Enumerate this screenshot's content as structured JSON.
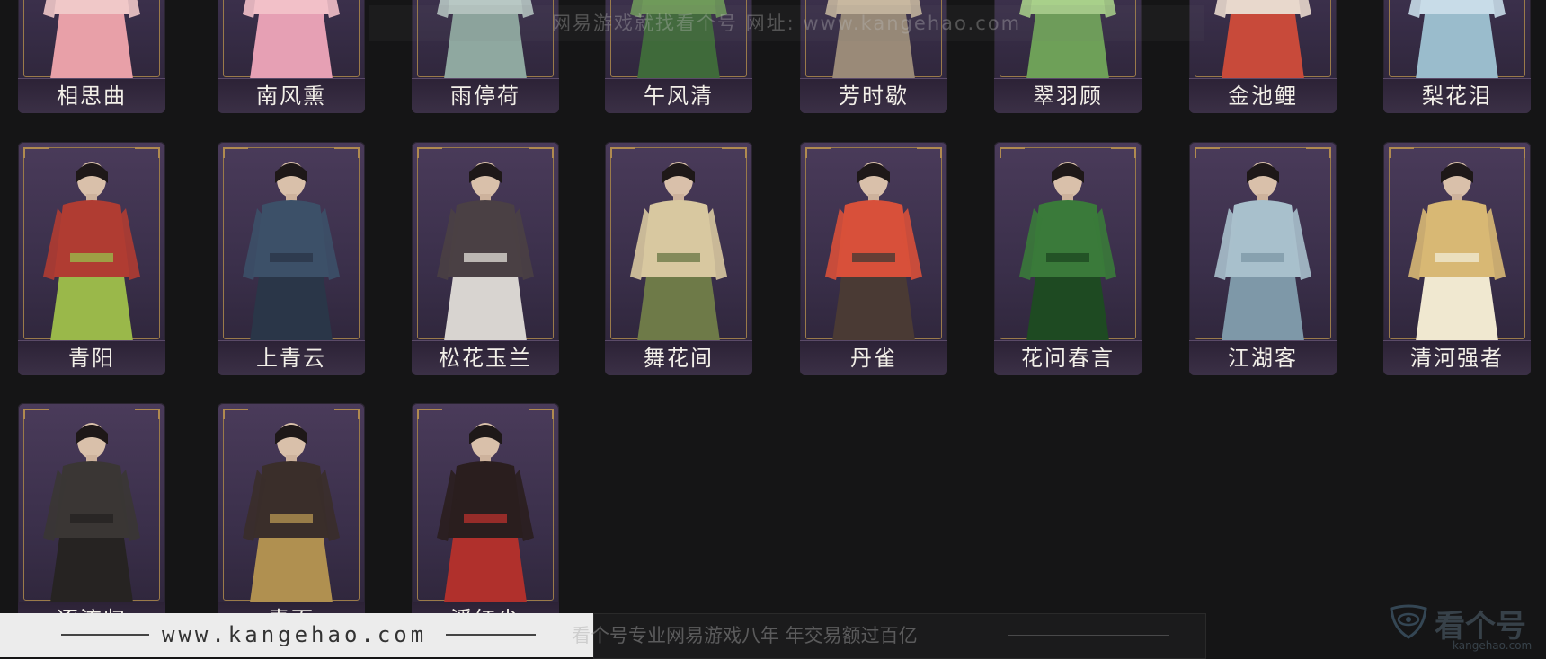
{
  "watermark_top": "网易游戏就找看个号  网址: www.kangehao.com",
  "footer": {
    "url": "www.kangehao.com",
    "slogan": "看个号专业网易游戏八年  年交易额过百亿"
  },
  "logo": {
    "name": "看个号",
    "sub": "kangehao.com"
  },
  "rows": [
    {
      "items": [
        {
          "name": "相思曲",
          "colors": [
            "#f0c8c8",
            "#e8a0a8"
          ]
        },
        {
          "name": "南风熏",
          "colors": [
            "#f2c0c8",
            "#e6a0b4"
          ]
        },
        {
          "name": "雨停荷",
          "colors": [
            "#b8c8c4",
            "#8fa8a0"
          ]
        },
        {
          "name": "午风清",
          "colors": [
            "#6f9a5a",
            "#3f6a3a"
          ]
        },
        {
          "name": "芳时歇",
          "colors": [
            "#c8b8a0",
            "#9a8a78"
          ]
        },
        {
          "name": "翠羽顾",
          "colors": [
            "#a8d08a",
            "#6ea058"
          ]
        },
        {
          "name": "金池鲤",
          "colors": [
            "#e8d8cc",
            "#c84a3a"
          ]
        },
        {
          "name": "梨花泪",
          "colors": [
            "#c8dce8",
            "#9abccc"
          ]
        }
      ]
    },
    {
      "items": [
        {
          "name": "青阳",
          "colors": [
            "#b03c32",
            "#9ab84a"
          ]
        },
        {
          "name": "上青云",
          "colors": [
            "#3c5068",
            "#2a3648"
          ]
        },
        {
          "name": "松花玉兰",
          "colors": [
            "#4a4044",
            "#d8d4d0"
          ]
        },
        {
          "name": "舞花间",
          "colors": [
            "#d8c8a0",
            "#6e7a48"
          ]
        },
        {
          "name": "丹雀",
          "colors": [
            "#d8503a",
            "#4a3a34"
          ]
        },
        {
          "name": "花问春言",
          "colors": [
            "#3a7a3a",
            "#1e4a22"
          ]
        },
        {
          "name": "江湖客",
          "colors": [
            "#a8c0cc",
            "#7e98a8"
          ]
        },
        {
          "name": "清河强者",
          "colors": [
            "#d8b874",
            "#f0e8d0"
          ]
        }
      ]
    },
    {
      "items": [
        {
          "name": "逐流归",
          "colors": [
            "#3a3634",
            "#262322"
          ]
        },
        {
          "name": "青面",
          "colors": [
            "#3a2e2a",
            "#b09050"
          ]
        },
        {
          "name": "浮红尘",
          "colors": [
            "#2a1e1e",
            "#b0302c"
          ]
        }
      ]
    }
  ]
}
